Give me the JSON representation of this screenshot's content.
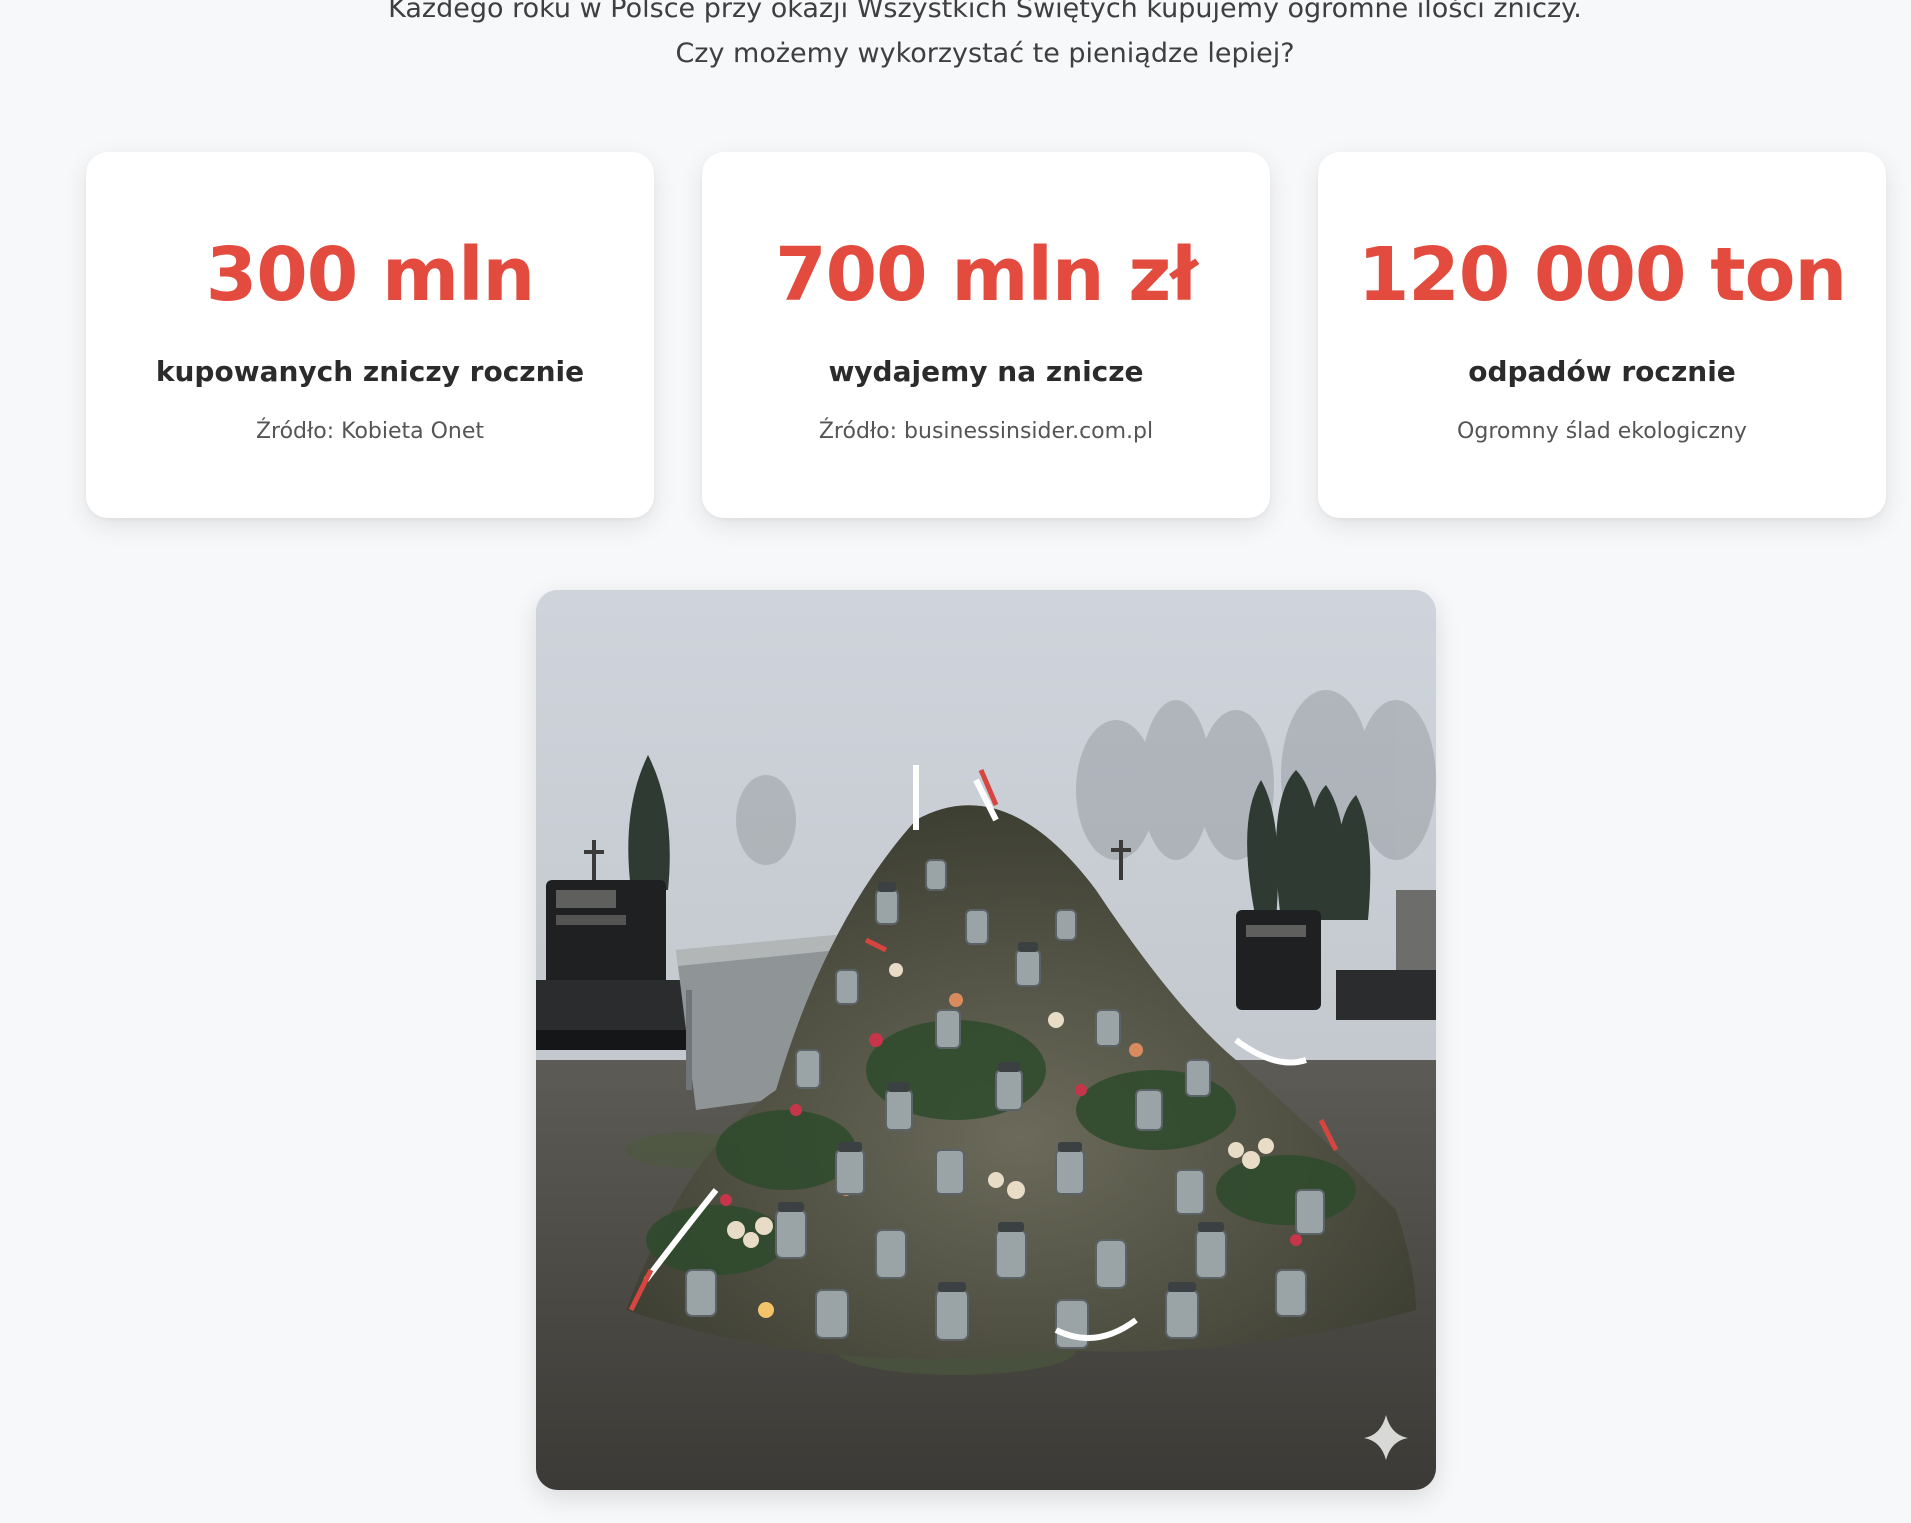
{
  "intro": {
    "text": "Każdego roku w Polsce przy okazji Wszystkich Świętych kupujemy ogromne ilości zniczy. Czy możemy wykorzystać te pieniądze lepiej?"
  },
  "stats": [
    {
      "value": "300 mln",
      "label": "kupowanych zniczy rocznie",
      "source": "Źródło: Kobieta Onet"
    },
    {
      "value": "700 mln zł",
      "label": "wydajemy na znicze",
      "source": "Źródło: businessinsider.com.pl"
    },
    {
      "value": "120 000 ton",
      "label": "odpadów rocznie",
      "source": "Ogromny ślad ekologiczny"
    }
  ],
  "colors": {
    "accent": "#e34b3f",
    "background": "#f7f8fa",
    "card": "#ffffff"
  },
  "image": {
    "icon": "sparkle-icon"
  }
}
